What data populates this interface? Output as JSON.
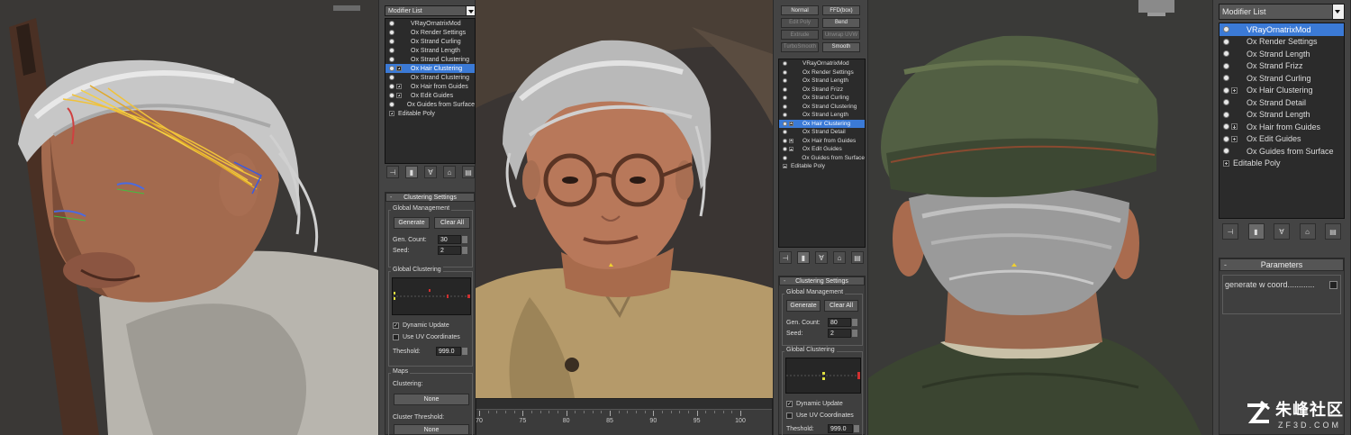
{
  "panel_left": {
    "modifier_list": "Modifier List",
    "stack": [
      {
        "label": "VRayOrnatrixMod",
        "icon": "bulb",
        "selected": false
      },
      {
        "label": "Ox Render Settings",
        "icon": "bulb",
        "selected": false
      },
      {
        "label": "Ox Strand Curling",
        "icon": "bulb",
        "selected": false
      },
      {
        "label": "Ox Strand Length",
        "icon": "bulb",
        "selected": false
      },
      {
        "label": "Ox Strand Clustering",
        "icon": "bulb",
        "selected": false
      },
      {
        "label": "Ox Hair Clustering",
        "icon": "bulb-plus",
        "selected": true
      },
      {
        "label": "Ox Strand Clustering",
        "icon": "bulb",
        "selected": false
      },
      {
        "label": "Ox Hair from Guides",
        "icon": "bulb-plus",
        "selected": false
      },
      {
        "label": "Ox Edit Guides",
        "icon": "bulb-plus",
        "selected": false
      },
      {
        "label": "Ox Guides from Surface",
        "icon": "bulb",
        "selected": false
      },
      {
        "label": "Editable Poly",
        "icon": "plus",
        "selected": false
      }
    ],
    "clustering": {
      "title": "Clustering Settings",
      "global_management": "Global Management",
      "generate": "Generate",
      "clear_all": "Clear All",
      "gen_count_label": "Gen. Count:",
      "gen_count": "30",
      "seed_label": "Seed:",
      "seed": "2",
      "global_clustering": "Global Clustering",
      "dynamic_update": "Dynamic Update",
      "use_uv": "Use UV Coordinates",
      "threshold_label": "Theshold:",
      "threshold": "999.0",
      "maps": "Maps",
      "clustering_label": "Clustering:",
      "none1": "None",
      "cluster_threshold_label": "Cluster Threshold:",
      "none2": "None"
    }
  },
  "panel_mid": {
    "buttons": [
      {
        "label": "Normal",
        "dim": false
      },
      {
        "label": "FFD(box)",
        "dim": false
      },
      {
        "label": "Edit Poly",
        "dim": true
      },
      {
        "label": "Bend",
        "dim": false
      },
      {
        "label": "Extrude",
        "dim": true
      },
      {
        "label": "Unwrap UVW",
        "dim": true
      },
      {
        "label": "TurboSmooth",
        "dim": true
      },
      {
        "label": "Smooth",
        "dim": false
      }
    ],
    "stack": [
      {
        "label": "VRayOrnatrixMod",
        "icon": "bulb",
        "selected": false
      },
      {
        "label": "Ox Render Settings",
        "icon": "bulb",
        "selected": false
      },
      {
        "label": "Ox Strand Length",
        "icon": "bulb",
        "selected": false
      },
      {
        "label": "Ox Strand Frizz",
        "icon": "bulb",
        "selected": false
      },
      {
        "label": "Ox Strand Curling",
        "icon": "bulb",
        "selected": false
      },
      {
        "label": "Ox Strand Clustering",
        "icon": "bulb",
        "selected": false
      },
      {
        "label": "Ox Strand Length",
        "icon": "bulb",
        "selected": false
      },
      {
        "label": "Ox Hair Clustering",
        "icon": "bulb-plus",
        "selected": true
      },
      {
        "label": "Ox Strand Detail",
        "icon": "bulb",
        "selected": false
      },
      {
        "label": "Ox Hair from Guides",
        "icon": "bulb-plus",
        "selected": false
      },
      {
        "label": "Ox Edit Guides",
        "icon": "bulb-plus",
        "selected": false
      },
      {
        "label": "Ox Guides from Surface",
        "icon": "bulb",
        "selected": false
      },
      {
        "label": "Editable Poly",
        "icon": "plus",
        "selected": false
      }
    ],
    "clustering": {
      "title": "Clustering Settings",
      "global_management": "Global Management",
      "generate": "Generate",
      "clear_all": "Clear All",
      "gen_count_label": "Gen. Count:",
      "gen_count": "80",
      "seed_label": "Seed:",
      "seed": "2",
      "global_clustering": "Global Clustering",
      "dynamic_update": "Dynamic Update",
      "use_uv": "Use UV Coordinates",
      "threshold_label": "Theshold:",
      "threshold": "999.0"
    }
  },
  "timeline": {
    "labels": [
      "70",
      "75",
      "80",
      "85",
      "90",
      "95",
      "100"
    ]
  },
  "panel_right": {
    "modifier_list": "Modifier List",
    "stack": [
      {
        "label": "VRayOrnatrixMod",
        "icon": "bulb",
        "selected": true
      },
      {
        "label": "Ox Render Settings",
        "icon": "bulb",
        "selected": false
      },
      {
        "label": "Ox Strand Length",
        "icon": "bulb",
        "selected": false
      },
      {
        "label": "Ox Strand Frizz",
        "icon": "bulb",
        "selected": false
      },
      {
        "label": "Ox Strand Curling",
        "icon": "bulb",
        "selected": false
      },
      {
        "label": "Ox Hair Clustering",
        "icon": "bulb-plus",
        "selected": false
      },
      {
        "label": "Ox Strand Detail",
        "icon": "bulb",
        "selected": false
      },
      {
        "label": "Ox Strand Length",
        "icon": "bulb",
        "selected": false
      },
      {
        "label": "Ox Hair from Guides",
        "icon": "bulb-plus",
        "selected": false
      },
      {
        "label": "Ox Edit Guides",
        "icon": "bulb-plus",
        "selected": false
      },
      {
        "label": "Ox Guides from Surface",
        "icon": "bulb",
        "selected": false
      },
      {
        "label": "Editable Poly",
        "icon": "plus",
        "selected": false
      }
    ],
    "parameters": {
      "title": "Parameters",
      "generate_w_coord": "generate w coord............"
    }
  },
  "watermark": {
    "title": "朱峰社区",
    "sub": "ZF3D.COM"
  },
  "icons": {
    "pin": "pin-icon",
    "show_end": "show-end-result-icon",
    "make_unique": "make-unique-icon",
    "remove": "remove-modifier-icon",
    "configure": "configure-sets-icon"
  }
}
